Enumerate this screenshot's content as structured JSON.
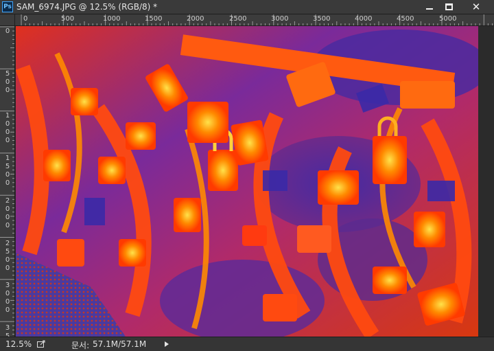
{
  "window": {
    "app_icon": "Ps",
    "title": "SAM_6974.JPG @ 12.5% (RGB/8) *",
    "controls": [
      "minimize-icon",
      "maximize-icon",
      "close-icon"
    ]
  },
  "rulers": {
    "horizontal": [
      "0",
      "500",
      "1000",
      "1500",
      "2000",
      "2500",
      "3000",
      "3500",
      "4000",
      "4500",
      "5000"
    ],
    "vertical": [
      "0",
      "500",
      "1000",
      "1500",
      "2000",
      "2500",
      "3000",
      "35"
    ]
  },
  "status": {
    "zoom": "12.5%",
    "doc_label": "문서:",
    "doc_size": "57.1M/57.1M"
  },
  "colors": {
    "background": "#2b2b2b",
    "image_hot": "#ff3a00",
    "image_cool": "#3a2aa8",
    "image_highlight": "#ffe24a"
  }
}
